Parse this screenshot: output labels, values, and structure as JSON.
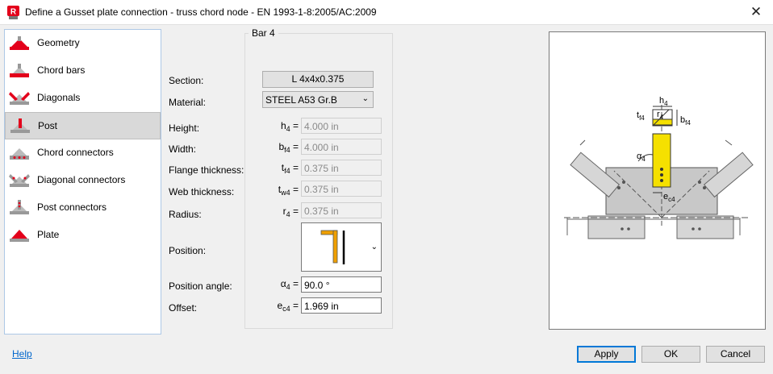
{
  "window": {
    "title": "Define a Gusset plate connection - truss chord node - EN 1993-1-8:2005/AC:2009",
    "app_icon_letter": "R",
    "close_glyph": "✕"
  },
  "nav": {
    "items": [
      {
        "label": "Geometry",
        "icon": "geometry-icon"
      },
      {
        "label": "Chord bars",
        "icon": "chord-bars-icon"
      },
      {
        "label": "Diagonals",
        "icon": "diagonals-icon"
      },
      {
        "label": "Post",
        "icon": "post-icon",
        "selected": true
      },
      {
        "label": "Chord connectors",
        "icon": "chord-connectors-icon"
      },
      {
        "label": "Diagonal connectors",
        "icon": "diagonal-connectors-icon"
      },
      {
        "label": "Post connectors",
        "icon": "post-connectors-icon"
      },
      {
        "label": "Plate",
        "icon": "plate-icon"
      }
    ]
  },
  "group": {
    "title": "Bar 4"
  },
  "form": {
    "section_label": "Section:",
    "section_value": "L 4x4x0.375",
    "material_label": "Material:",
    "material_value": "STEEL A53 Gr.B",
    "height_label": "Height:",
    "height_sym": "h",
    "height_sub": "4",
    "height_value": "4.000 in",
    "width_label": "Width:",
    "width_sym": "b",
    "width_sub": "f4",
    "width_value": "4.000 in",
    "flange_label": "Flange thickness:",
    "flange_sym": "t",
    "flange_sub": "f4",
    "flange_value": "0.375 in",
    "web_label": "Web thickness:",
    "web_sym": "t",
    "web_sub": "w4",
    "web_value": "0.375 in",
    "radius_label": "Radius:",
    "radius_sym": "r",
    "radius_sub": "4",
    "radius_value": "0.375 in",
    "position_label": "Position:",
    "angle_label": "Position angle:",
    "angle_sym": "α",
    "angle_sub": "4",
    "angle_value": "90.0 °",
    "offset_label": "Offset:",
    "offset_sym": "e",
    "offset_sub": "c4",
    "offset_value": "1.969 in",
    "eq": "="
  },
  "diagram": {
    "h4": "h",
    "h4s": "4",
    "r4": "r",
    "r4s": "4",
    "tf4": "t",
    "tf4s": "f4",
    "bf4": "b",
    "bf4s": "f4",
    "a4": "α",
    "a4s": "4",
    "ec4": "e",
    "ec4s": "c4"
  },
  "footer": {
    "help": "Help",
    "apply": "Apply",
    "ok": "OK",
    "cancel": "Cancel"
  },
  "colors": {
    "accent": "#0078d7",
    "icon_red": "#e3001b",
    "post_yellow": "#f5e000"
  }
}
